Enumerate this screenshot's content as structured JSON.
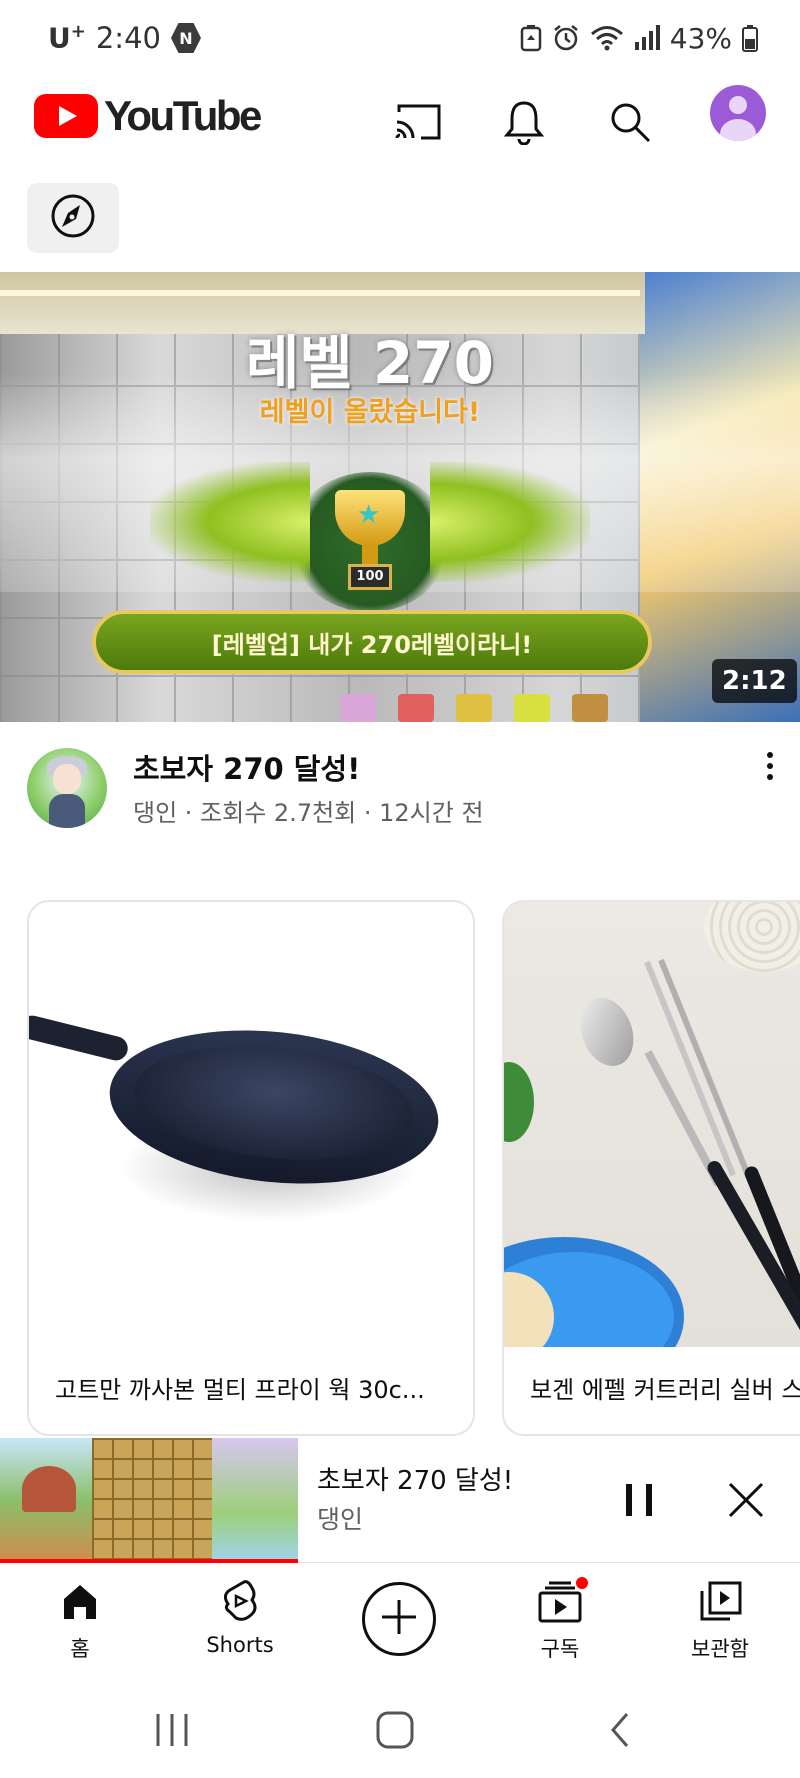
{
  "status_bar": {
    "carrier": "U",
    "carrier_plus": "+",
    "time": "2:40",
    "battery": "43%",
    "icons": [
      "n-badge-icon",
      "battery-saver-icon",
      "alarm-icon",
      "wifi-icon",
      "signal-icon",
      "battery-icon"
    ]
  },
  "header": {
    "logo_text": "YouTube",
    "icons": [
      "cast-icon",
      "notifications-icon",
      "search-icon",
      "account-avatar"
    ]
  },
  "explore": {
    "icon": "compass-icon"
  },
  "video": {
    "thumbnail_heading": "레벨 270",
    "thumbnail_subheading": "레벨이 올랐습니다!",
    "thumbnail_trophy_label": "100",
    "thumbnail_banner": "[레벨업] 내가 270레벨이라니!",
    "duration": "2:12",
    "title": "초보자 270 달성!",
    "meta": "댕인 · 조회수 2.7천회 · 12시간 전"
  },
  "products": [
    {
      "title": "고트만 까사본 멀티 프라이 웍 30c..."
    },
    {
      "title": "보겐 에펠 커트러리 실버 스"
    }
  ],
  "mini_player": {
    "title": "초보자 270 달성!",
    "channel": "댕인",
    "progress": 1.0
  },
  "bottom_nav": {
    "items": [
      {
        "label": "홈",
        "icon": "home-icon"
      },
      {
        "label": "Shorts",
        "icon": "shorts-icon"
      },
      {
        "label": "",
        "icon": "create-icon"
      },
      {
        "label": "구독",
        "icon": "subscriptions-icon"
      },
      {
        "label": "보관함",
        "icon": "library-icon"
      }
    ]
  },
  "system_nav": {
    "icons": [
      "recents-icon",
      "home-button-icon",
      "back-icon"
    ]
  },
  "colors": {
    "brand_red": "#ff0000",
    "text_primary": "#0f0f0f",
    "text_secondary": "#606060"
  }
}
